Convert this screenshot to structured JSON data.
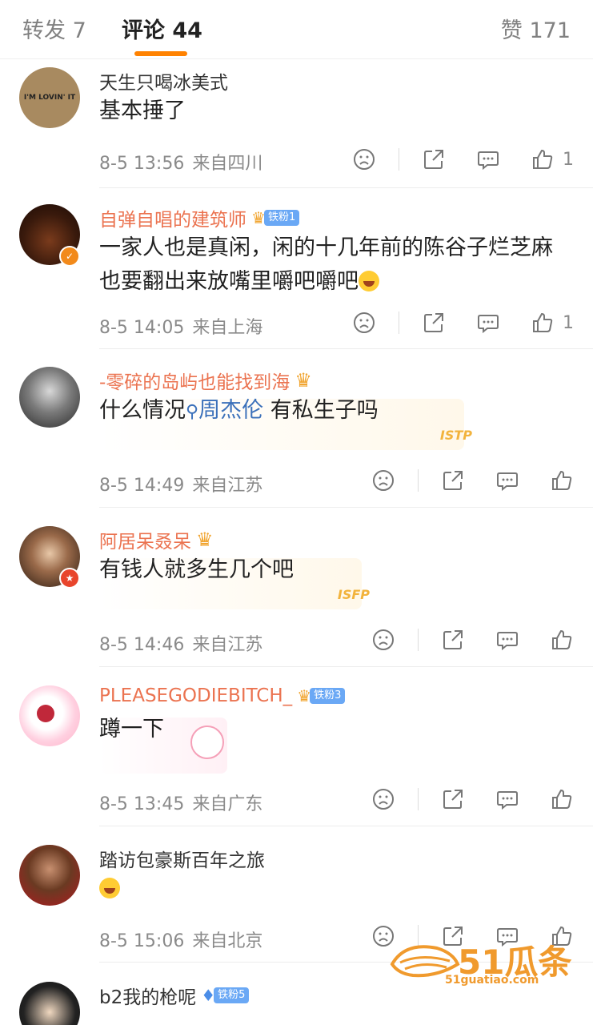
{
  "tabs": {
    "repost": "转发 7",
    "comments": "评论 44",
    "likes": "赞 171"
  },
  "comments": [
    {
      "username": "天生只喝冰美式",
      "text": "基本捶了",
      "time": "8-5 13:56",
      "location": "来自四川",
      "like_count": "1",
      "avatar_text": "I'M LOVIN' IT"
    },
    {
      "username": "自弹自唱的建筑师",
      "fan_badge": "铁粉1",
      "text": "一家人也是真闲，闲的十几年前的陈谷子烂芝麻也要翻出来放嘴里嚼吧嚼吧",
      "time": "8-5 14:05",
      "location": "来自上海",
      "like_count": "1"
    },
    {
      "username": "-零碎的岛屿也能找到海",
      "text_before": "什么情况",
      "topic": "周杰伦",
      "text_after": " 有私生子吗",
      "deco_text": "ISTP",
      "time": "8-5 14:49",
      "location": "来自江苏",
      "like_count": ""
    },
    {
      "username": "阿居呆叒呆",
      "text": "有钱人就多生几个吧",
      "deco_text": "ISFP",
      "time": "8-5 14:46",
      "location": "来自江苏",
      "like_count": ""
    },
    {
      "username": "PLEASEGODIEBITCH_",
      "fan_badge": "铁粉3",
      "text": "蹲一下",
      "time": "8-5 13:45",
      "location": "来自广东",
      "like_count": ""
    },
    {
      "username": "踏访包豪斯百年之旅",
      "text": "",
      "time": "8-5 15:06",
      "location": "来自北京",
      "like_count": ""
    },
    {
      "username": "b2我的枪呢",
      "fan_badge": "铁粉5"
    }
  ],
  "watermark": {
    "main": "51瓜条",
    "sub": "51guatiao.com"
  },
  "colors": {
    "accent": "#ff8200",
    "username_vip": "#eb7350",
    "topic_link": "#3b70ba",
    "meta_gray": "#8a8a8a"
  }
}
